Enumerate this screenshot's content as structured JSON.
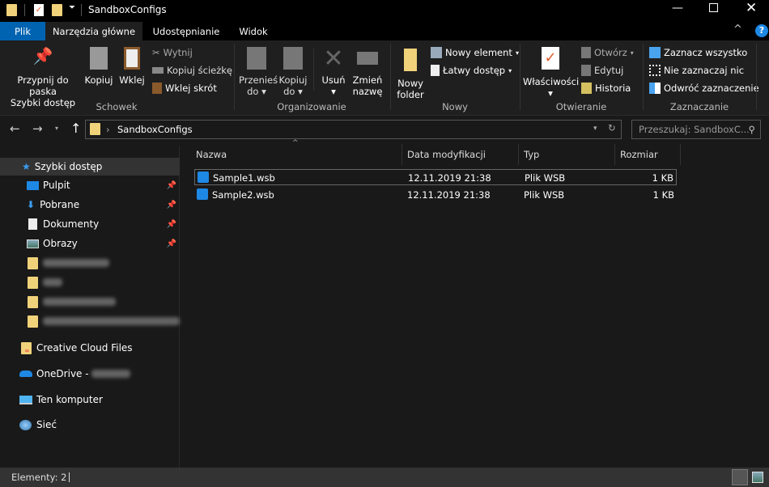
{
  "window": {
    "title": "SandboxConfigs"
  },
  "tabs": [
    {
      "label": "Plik"
    },
    {
      "label": "Narzędzia główne"
    },
    {
      "label": "Udostępnianie"
    },
    {
      "label": "Widok"
    }
  ],
  "ribbon": {
    "schowek": {
      "label": "Schowek",
      "pin": "Przypnij do paska",
      "pin2": "Szybki dostęp",
      "copy": "Kopiuj",
      "paste": "Wklej",
      "cut": "Wytnij",
      "copy_path": "Kopiuj ścieżkę",
      "paste_shortcut": "Wklej skrót"
    },
    "organizowanie": {
      "label": "Organizowanie",
      "move": "Przenieś",
      "move2": "do",
      "copyto": "Kopiuj",
      "copyto2": "do",
      "delete": "Usuń",
      "rename": "Zmień",
      "rename2": "nazwę"
    },
    "nowy": {
      "label": "Nowy",
      "new_folder": "Nowy",
      "new_folder2": "folder",
      "new_item": "Nowy element",
      "easy_access": "Łatwy dostęp"
    },
    "otwieranie": {
      "label": "Otwieranie",
      "properties": "Właściwości",
      "open": "Otwórz",
      "edit": "Edytuj",
      "history": "Historia"
    },
    "zaznaczanie": {
      "label": "Zaznaczanie",
      "select_all": "Zaznacz wszystko",
      "select_none": "Nie zaznaczaj nic",
      "invert": "Odwróć zaznaczenie"
    }
  },
  "address": {
    "path": "SandboxConfigs",
    "search_placeholder": "Przeszukaj: SandboxC..."
  },
  "nav": {
    "quick_access": "Szybki dostęp",
    "pinned": [
      {
        "label": "Pulpit"
      },
      {
        "label": "Pobrane"
      },
      {
        "label": "Dokumenty"
      },
      {
        "label": "Obrazy"
      }
    ],
    "creative_cloud": "Creative Cloud Files",
    "onedrive": "OneDrive -",
    "this_pc": "Ten komputer",
    "network": "Sieć"
  },
  "columns": [
    "Nazwa",
    "Data modyfikacji",
    "Typ",
    "Rozmiar"
  ],
  "files": [
    {
      "name": "Sample1.wsb",
      "date": "12.11.2019 21:38",
      "type": "Plik WSB",
      "size": "1 KB"
    },
    {
      "name": "Sample2.wsb",
      "date": "12.11.2019 21:38",
      "type": "Plik WSB",
      "size": "1 KB"
    }
  ],
  "status": {
    "items": "Elementy: 2"
  },
  "colors": {
    "accent": "#0063b1",
    "background": "#191919",
    "ribbon": "#1f1f1f",
    "folder": "#f0d27a"
  }
}
